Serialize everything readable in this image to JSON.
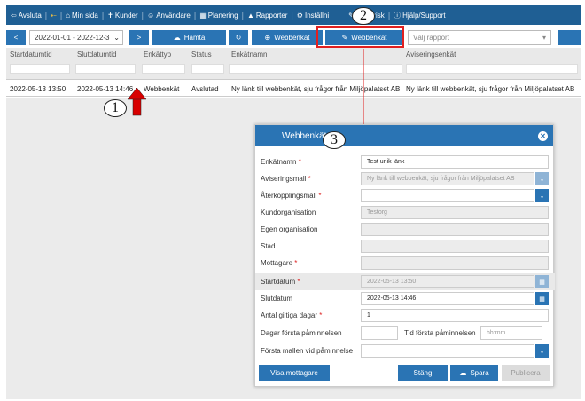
{
  "nav": {
    "items": [
      {
        "icon": "⇦",
        "label": "Avsluta"
      },
      {
        "icon": "⇠",
        "label": ""
      },
      {
        "icon": "⌂",
        "label": "Min sida"
      },
      {
        "icon": "✝",
        "label": "Kunder"
      },
      {
        "icon": "☺",
        "label": "Användare"
      },
      {
        "icon": "▦",
        "label": "Planering"
      },
      {
        "icon": "▲",
        "label": "Rapporter"
      },
      {
        "icon": "⚙",
        "label": "Inställni"
      },
      {
        "icon": "✎",
        "label": "Generisk"
      },
      {
        "icon": "ⓘ",
        "label": "Hjälp/Support"
      }
    ]
  },
  "toolbar": {
    "prev": "<",
    "date_range": "2022-01-01 - 2022-12-3",
    "next": ">",
    "fetch_label": "Hämta",
    "refresh_label": "↻",
    "new_survey_label": "Webbenkät",
    "survey_label": "Webbenkät",
    "report_placeholder": "Välj rapport"
  },
  "table": {
    "columns": [
      "Startdatumtid",
      "Slutdatumtid",
      "Enkättyp",
      "Status",
      "Enkätnamn",
      "Aviseringsenkät"
    ],
    "row": [
      "2022-05-13 13:50",
      "2022-05-13 14:46",
      "Webbenkät",
      "Avslutad",
      "Ny länk till webbenkät, sju frågor från Miljöpalatset AB",
      "Ny länk till webbenkät, sju frågor från Miljöpalatset AB"
    ]
  },
  "annotations": {
    "one": "1",
    "two": "2",
    "three": "3"
  },
  "modal": {
    "title": "Webbenkät",
    "fields": {
      "enkatnamn": {
        "label": "Enkätnamn",
        "value": "Test unik länk"
      },
      "aviseringsmall": {
        "label": "Aviseringsmall",
        "value": "Ny länk till webbenkät, sju frågor från Miljöpalatset AB"
      },
      "aterkopplingsmall": {
        "label": "Återkopplingsmall",
        "value": ""
      },
      "kundorganisation": {
        "label": "Kundorganisation",
        "value": "Testorg"
      },
      "egen_organisation": {
        "label": "Egen organisation",
        "value": ""
      },
      "stad": {
        "label": "Stad",
        "value": ""
      },
      "mottagare": {
        "label": "Mottagare",
        "value": ""
      },
      "startdatum": {
        "label": "Startdatum",
        "value": "2022-05-13 13:50"
      },
      "slutdatum": {
        "label": "Slutdatum",
        "value": "2022-05-13 14:46"
      },
      "antal_dagar": {
        "label": "Antal giltiga dagar",
        "value": "1"
      },
      "dagar_paminnelse": {
        "label": "Dagar första påminnelsen",
        "value": ""
      },
      "tid_paminnelse": {
        "label": "Tid första påminnelsen",
        "placeholder": "hh:mm"
      },
      "forsta_mallen": {
        "label": "Första mallen vid påminnelse",
        "value": ""
      }
    },
    "buttons": {
      "recipients": "Visa mottagare",
      "close": "Stäng",
      "save": "Spara",
      "publish": "Publicera"
    }
  }
}
